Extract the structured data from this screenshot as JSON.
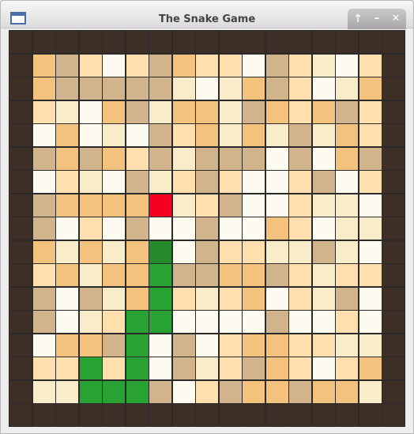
{
  "window": {
    "title": "The Snake Game"
  },
  "wm": {
    "maximize_glyph": "🡑",
    "minimize_glyph": "–",
    "close_glyph": "✕"
  },
  "board": {
    "cols": 17,
    "rows": 17,
    "palette": {
      "W": "#3e2f26",
      "A": "#f3c27c",
      "B": "#d2b48c",
      "C": "#ffdfae",
      "D": "#fdfbf0",
      "E": "#f8ecc9",
      "G": "#27a233",
      "H": "#248a2c",
      "R": "#f50020"
    },
    "grid": [
      "WWWWWWWWWWWWWWWWW",
      "WABCDCBACCDBCEDCW",
      "WABBBBBEDEABCDEAW",
      "WCEDABEAAEBACABCW",
      "WDADEDBCAEAEBEACW",
      "WBABACBEBBBDBDABW",
      "WDCEDBECBCDDCBDCW",
      "WBAAAARECBDDCEEDW",
      "WBDCDBDDBDDACDEEW",
      "WAEAEAHDBCCEEBED",
      "WCAEAAGBBAABCECCW",
      "WBDBEAGCECADCEBDW",
      "WBDECGGDDDDBDDCDW",
      "WDAABGDBDCAACCEEW",
      "WCCGCGDBECBACDCAW",
      "WEEGGGBDCBAABAAEW",
      "WWWWWWWWWWWWWWWWW"
    ]
  }
}
